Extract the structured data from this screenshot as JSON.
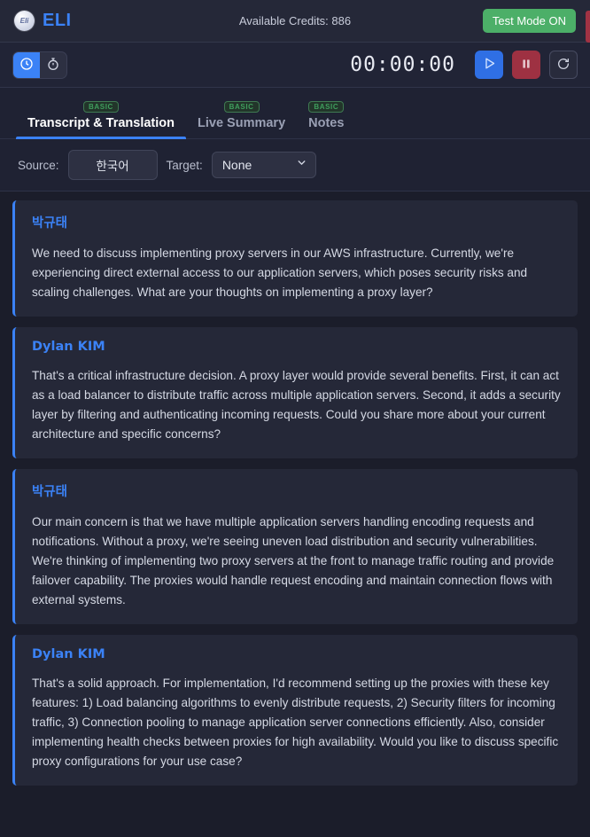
{
  "header": {
    "brand_name": "ELI",
    "logo_text": "Eli",
    "logo_icon": "eli-circle-logo",
    "credits_text": "Available Credits: 886",
    "test_mode_label": "Test Mode ON",
    "accent_color": "#3b82f6",
    "test_mode_color": "#4caf68"
  },
  "controls": {
    "mode_clock_icon": "clock-icon",
    "mode_stopwatch_icon": "stopwatch-icon",
    "active_mode": "clock",
    "timer": "00:00:00",
    "play_icon": "play-icon",
    "pause_icon": "pause-icon",
    "reset_icon": "refresh-icon"
  },
  "tabs": [
    {
      "label": "Transcript & Translation",
      "badge": "BASIC",
      "active": true
    },
    {
      "label": "Live Summary",
      "badge": "BASIC",
      "active": false
    },
    {
      "label": "Notes",
      "badge": "BASIC",
      "active": false
    }
  ],
  "language_bar": {
    "source_label": "Source:",
    "source_value": "한국어",
    "target_label": "Target:",
    "target_value": "None",
    "target_options": [
      "None"
    ],
    "chevron_icon": "chevron-down-icon"
  },
  "messages": [
    {
      "speaker": "박규태",
      "text": "We need to discuss implementing proxy servers in our AWS infrastructure. Currently, we're experiencing direct external access to our application servers, which poses security risks and scaling challenges. What are your thoughts on implementing a proxy layer?"
    },
    {
      "speaker": "Dylan KIM",
      "text": "That's a critical infrastructure decision. A proxy layer would provide several benefits. First, it can act as a load balancer to distribute traffic across multiple application servers. Second, it adds a security layer by filtering and authenticating incoming requests. Could you share more about your current architecture and specific concerns?"
    },
    {
      "speaker": "박규태",
      "text": "Our main concern is that we have multiple application servers handling encoding requests and notifications. Without a proxy, we're seeing uneven load distribution and security vulnerabilities. We're thinking of implementing two proxy servers at the front to manage traffic routing and provide failover capability. The proxies would handle request encoding and maintain connection flows with external systems."
    },
    {
      "speaker": "Dylan KIM",
      "text": "That's a solid approach. For implementation, I'd recommend setting up the proxies with these key features: 1) Load balancing algorithms to evenly distribute requests, 2) Security filters for incoming traffic, 3) Connection pooling to manage application server connections efficiently. Also, consider implementing health checks between proxies for high availability. Would you like to discuss specific proxy configurations for your use case?"
    }
  ]
}
